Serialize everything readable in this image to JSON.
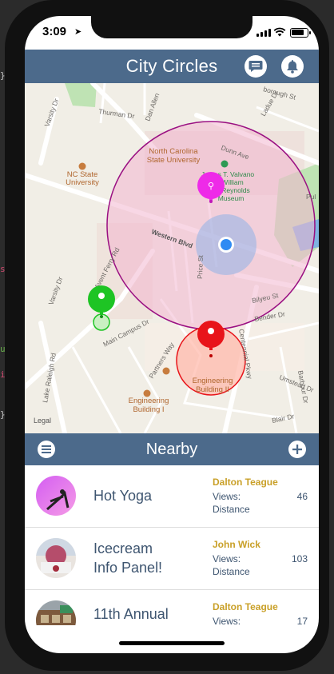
{
  "status": {
    "time": "3:09",
    "location_arrow": "location-arrow-icon"
  },
  "header": {
    "title": "City Circles",
    "left_icon": "chat-icon",
    "right_icon": "bell-icon"
  },
  "map": {
    "legal": "Legal",
    "labels": {
      "thurman": "Thurman Dr",
      "varsity_top": "Varsity Dr",
      "dan_allen": "Dan Allen",
      "ncsu_top": "North Carolina",
      "ncsu_bottom": "State University",
      "nc_state_a": "NC State",
      "nc_state_b": "University",
      "museum_a": "James T. Valvano",
      "museum_b": "William",
      "museum_c": "Reynolds",
      "museum_d": "Museum",
      "dunn": "Dunn Ave",
      "western": "Western Blvd",
      "varsity_left": "Varsity Dr",
      "ferry": "Avent Ferry Rd",
      "main_campus": "Main Campus Dr",
      "partners": "Partners Way",
      "price": "Price St",
      "bilyeu": "Bilyeu St",
      "bender": "Bender Dr",
      "centennial": "Centennial Pkwy",
      "umstead": "Umstead Dr",
      "barbour": "Barbour Dr",
      "blair": "Blair Dr",
      "lake_raleigh": "Lake Raleigh Rd",
      "eng2_a": "Engineering",
      "eng2_b": "Building II",
      "eng1_a": "Engineering",
      "eng1_b": "Building I",
      "borough": "borough St",
      "ladue": "Ladue Dr",
      "pul": "Pul"
    },
    "pins": [
      {
        "name": "magenta",
        "color": "#ee2ae8"
      },
      {
        "name": "green",
        "color": "#1ec424"
      },
      {
        "name": "red",
        "color": "#e8141a"
      }
    ],
    "user_location_color": "#2f8bf3"
  },
  "subbar": {
    "title": "Nearby",
    "left_icon": "menu-icon",
    "right_icon": "add-icon"
  },
  "items": [
    {
      "title_l1": "Hot Yoga",
      "title_l2": "",
      "author": "Dalton Teague",
      "views_label": "Views:",
      "views": "46",
      "distance_label": "Distance",
      "avatar": "yoga-avatar-icon"
    },
    {
      "title_l1": "Icecream",
      "title_l2": "Info Panel!",
      "author": "John Wick",
      "views_label": "Views:",
      "views": "103",
      "distance_label": "Distance",
      "avatar": "icecream-avatar-icon"
    },
    {
      "title_l1": "11th Annual",
      "title_l2": "",
      "author": "Dalton Teague",
      "views_label": "Views:",
      "views": "17",
      "distance_label": "",
      "avatar": "building-avatar-icon"
    }
  ],
  "colors": {
    "nav": "#4c6a8b",
    "accent_gold": "#c9a028",
    "text": "#3e5570"
  }
}
